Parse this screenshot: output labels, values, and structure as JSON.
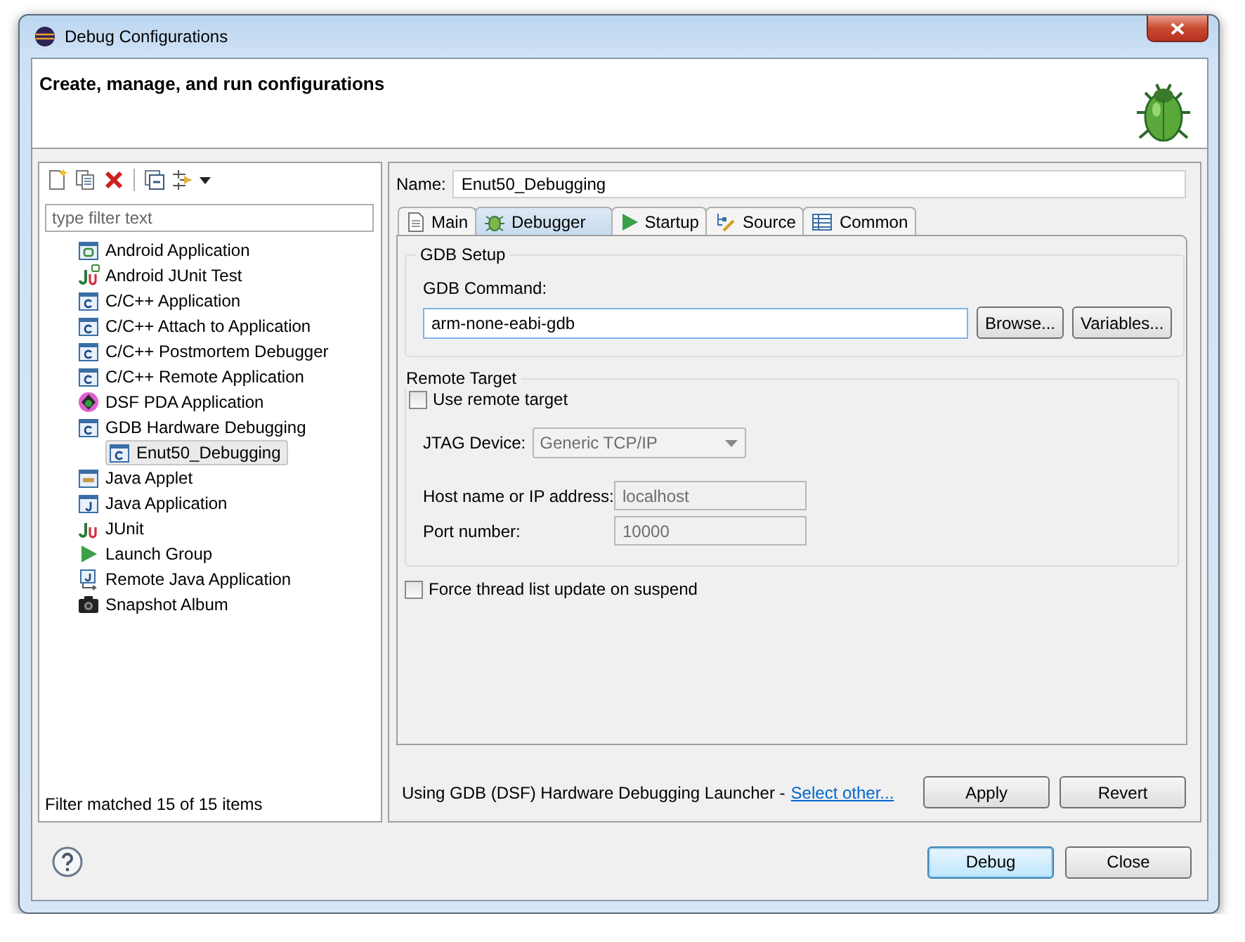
{
  "window": {
    "title": "Debug Configurations"
  },
  "header": {
    "message": "Create, manage, and run configurations"
  },
  "filter": {
    "placeholder": "type filter text"
  },
  "tree": [
    {
      "label": "Android Application",
      "kind": "android",
      "selected": false
    },
    {
      "label": "Android JUnit Test",
      "kind": "android-junit",
      "selected": false
    },
    {
      "label": "C/C++ Application",
      "kind": "c",
      "selected": false
    },
    {
      "label": "C/C++ Attach to Application",
      "kind": "c",
      "selected": false
    },
    {
      "label": "C/C++ Postmortem Debugger",
      "kind": "c",
      "selected": false
    },
    {
      "label": "C/C++ Remote Application",
      "kind": "c",
      "selected": false
    },
    {
      "label": "DSF PDA Application",
      "kind": "dsf",
      "selected": false
    },
    {
      "label": "GDB Hardware Debugging",
      "kind": "c",
      "selected": false,
      "children": [
        {
          "label": "Enut50_Debugging",
          "kind": "c",
          "selected": true
        }
      ]
    },
    {
      "label": "Java Applet",
      "kind": "applet",
      "selected": false
    },
    {
      "label": "Java Application",
      "kind": "java",
      "selected": false
    },
    {
      "label": "JUnit",
      "kind": "junit",
      "selected": false
    },
    {
      "label": "Launch Group",
      "kind": "launch",
      "selected": false
    },
    {
      "label": "Remote Java Application",
      "kind": "remote-java",
      "selected": false
    },
    {
      "label": "Snapshot Album",
      "kind": "camera",
      "selected": false
    }
  ],
  "filter_status": "Filter matched 15 of 15 items",
  "config": {
    "name_label": "Name:",
    "name": "Enut50_Debugging"
  },
  "tabs": [
    {
      "label": "Main",
      "kind": "main",
      "selected": false
    },
    {
      "label": "Debugger",
      "kind": "debugger",
      "selected": true
    },
    {
      "label": "Startup",
      "kind": "startup",
      "selected": false
    },
    {
      "label": "Source",
      "kind": "source",
      "selected": false
    },
    {
      "label": "Common",
      "kind": "common",
      "selected": false
    }
  ],
  "gdb_setup": {
    "title": "GDB Setup",
    "command_label": "GDB Command:",
    "command": "arm-none-eabi-gdb",
    "buttons": [
      "Browse...",
      "Variables..."
    ]
  },
  "remote_target": {
    "title": "Remote Target",
    "use_remote": {
      "label": "Use remote target",
      "checked": false
    },
    "jtag": {
      "label": "JTAG Device:",
      "value": "Generic TCP/IP",
      "disabled": true
    },
    "host": {
      "label": "Host name or IP address:",
      "value": "localhost",
      "disabled": true
    },
    "port": {
      "label": "Port number:",
      "value": "10000",
      "disabled": true
    }
  },
  "force_thread": {
    "label": "Force thread list update on suspend",
    "checked": false
  },
  "launcher": {
    "text": "Using GDB (DSF) Hardware Debugging Launcher -",
    "link": "Select other..."
  },
  "panel_buttons": [
    "Apply",
    "Revert"
  ],
  "dialog_buttons": [
    {
      "label": "Debug",
      "default": true
    },
    {
      "label": "Close",
      "default": false
    }
  ]
}
